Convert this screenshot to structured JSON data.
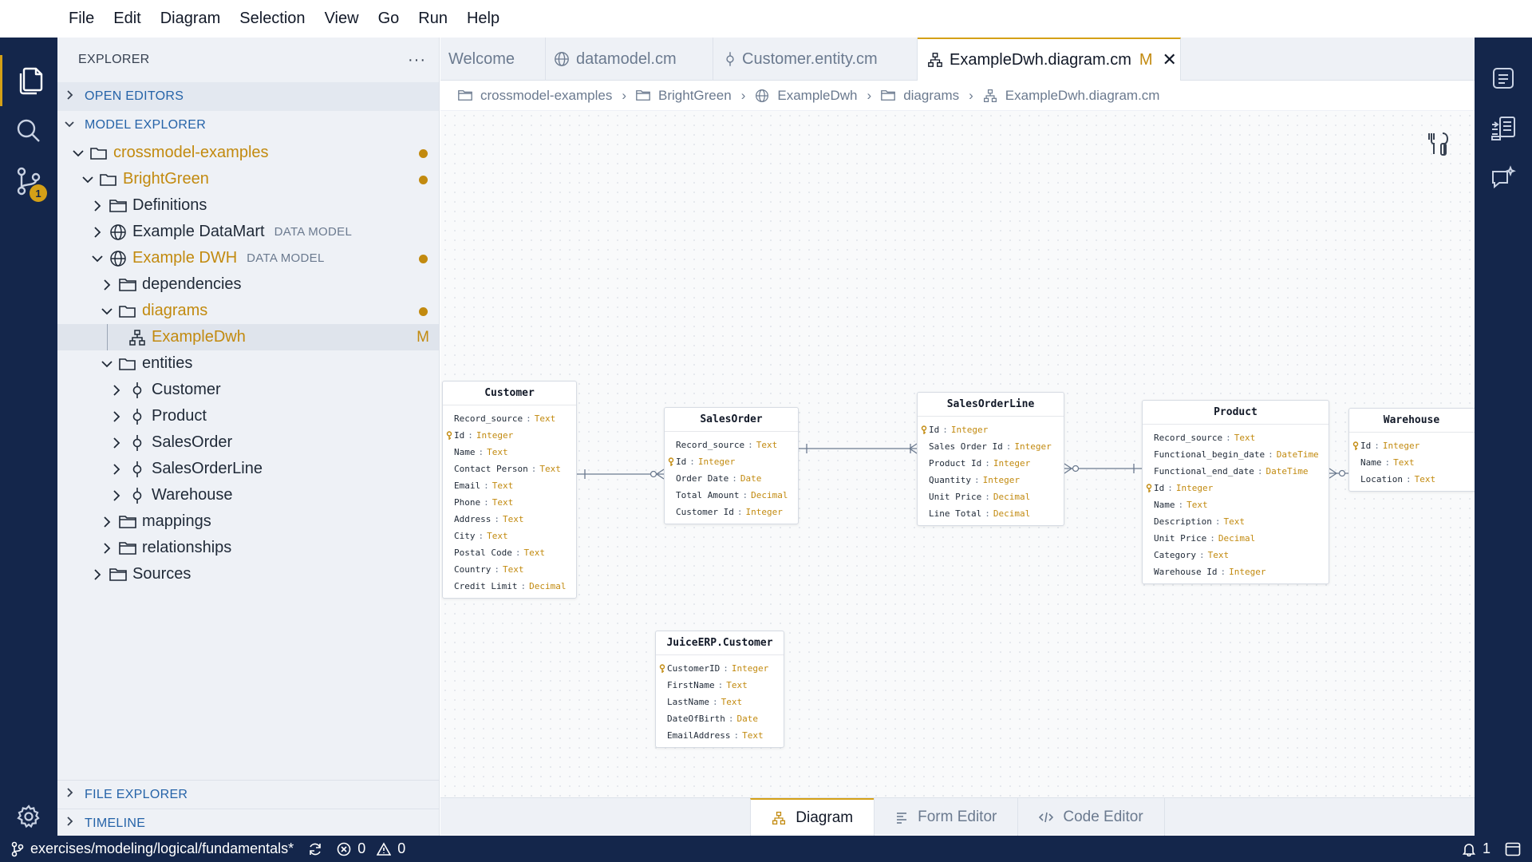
{
  "menu": [
    "File",
    "Edit",
    "Diagram",
    "Selection",
    "View",
    "Go",
    "Run",
    "Help"
  ],
  "activity": {
    "scm_badge": "1"
  },
  "explorer": {
    "title": "EXPLORER",
    "more": "···",
    "open_editors": "OPEN EDITORS",
    "model_explorer": "MODEL EXPLORER",
    "file_explorer": "FILE EXPLORER",
    "timeline": "TIMELINE",
    "tree": [
      {
        "label": "crossmodel-examples",
        "desc": "",
        "flag": "dot"
      },
      {
        "label": "BrightGreen",
        "desc": "",
        "flag": "dot"
      },
      {
        "label": "Definitions",
        "desc": "",
        "flag": ""
      },
      {
        "label": "Example DataMart",
        "desc": "DATA MODEL",
        "flag": ""
      },
      {
        "label": "Example DWH",
        "desc": "DATA MODEL",
        "flag": "dot"
      },
      {
        "label": "dependencies",
        "desc": "",
        "flag": ""
      },
      {
        "label": "diagrams",
        "desc": "",
        "flag": "dot"
      },
      {
        "label": "ExampleDwh",
        "desc": "",
        "flag": "M"
      },
      {
        "label": "entities",
        "desc": "",
        "flag": ""
      },
      {
        "label": "Customer",
        "desc": "",
        "flag": ""
      },
      {
        "label": "Product",
        "desc": "",
        "flag": ""
      },
      {
        "label": "SalesOrder",
        "desc": "",
        "flag": ""
      },
      {
        "label": "SalesOrderLine",
        "desc": "",
        "flag": ""
      },
      {
        "label": "Warehouse",
        "desc": "",
        "flag": ""
      },
      {
        "label": "mappings",
        "desc": "",
        "flag": ""
      },
      {
        "label": "relationships",
        "desc": "",
        "flag": ""
      },
      {
        "label": "Sources",
        "desc": "",
        "flag": ""
      }
    ]
  },
  "tabs": [
    {
      "label": "Welcome"
    },
    {
      "label": "datamodel.cm"
    },
    {
      "label": "Customer.entity.cm"
    },
    {
      "label": "ExampleDwh.diagram.cm",
      "modified": "M",
      "close": "✕"
    }
  ],
  "breadcrumb": [
    "crossmodel-examples",
    "BrightGreen",
    "ExampleDwh",
    "diagrams",
    "ExampleDwh.diagram.cm"
  ],
  "entities": {
    "customer": {
      "name": "Customer",
      "attrs": [
        {
          "n": "Record_source",
          "t": "Text"
        },
        {
          "n": "Id",
          "t": "Integer"
        },
        {
          "n": "Name",
          "t": "Text"
        },
        {
          "n": "Contact Person",
          "t": "Text"
        },
        {
          "n": "Email",
          "t": "Text"
        },
        {
          "n": "Phone",
          "t": "Text"
        },
        {
          "n": "Address",
          "t": "Text"
        },
        {
          "n": "City",
          "t": "Text"
        },
        {
          "n": "Postal Code",
          "t": "Text"
        },
        {
          "n": "Country",
          "t": "Text"
        },
        {
          "n": "Credit Limit",
          "t": "Decimal"
        }
      ]
    },
    "salesorder": {
      "name": "SalesOrder",
      "attrs": [
        {
          "n": "Record_source",
          "t": "Text"
        },
        {
          "n": "Id",
          "t": "Integer"
        },
        {
          "n": "Order Date",
          "t": "Date"
        },
        {
          "n": "Total Amount",
          "t": "Decimal"
        },
        {
          "n": "Customer Id",
          "t": "Integer"
        }
      ]
    },
    "salesorderline": {
      "name": "SalesOrderLine",
      "attrs": [
        {
          "n": "Id",
          "t": "Integer"
        },
        {
          "n": "Sales Order Id",
          "t": "Integer"
        },
        {
          "n": "Product Id",
          "t": "Integer"
        },
        {
          "n": "Quantity",
          "t": "Integer"
        },
        {
          "n": "Unit Price",
          "t": "Decimal"
        },
        {
          "n": "Line Total",
          "t": "Decimal"
        }
      ]
    },
    "product": {
      "name": "Product",
      "attrs": [
        {
          "n": "Record_source",
          "t": "Text"
        },
        {
          "n": "Functional_begin_date",
          "t": "DateTime"
        },
        {
          "n": "Functional_end_date",
          "t": "DateTime"
        },
        {
          "n": "Id",
          "t": "Integer"
        },
        {
          "n": "Name",
          "t": "Text"
        },
        {
          "n": "Description",
          "t": "Text"
        },
        {
          "n": "Unit Price",
          "t": "Decimal"
        },
        {
          "n": "Category",
          "t": "Text"
        },
        {
          "n": "Warehouse Id",
          "t": "Integer"
        }
      ]
    },
    "warehouse": {
      "name": "Warehouse",
      "attrs": [
        {
          "n": "Id",
          "t": "Integer"
        },
        {
          "n": "Name",
          "t": "Text"
        },
        {
          "n": "Location",
          "t": "Text"
        }
      ]
    },
    "juice": {
      "name": "JuiceERP.Customer",
      "attrs": [
        {
          "n": "CustomerID",
          "t": "Integer"
        },
        {
          "n": "FirstName",
          "t": "Text"
        },
        {
          "n": "LastName",
          "t": "Text"
        },
        {
          "n": "DateOfBirth",
          "t": "Date"
        },
        {
          "n": "EmailAddress",
          "t": "Text"
        }
      ]
    }
  },
  "editor_tabs": [
    "Diagram",
    "Form Editor",
    "Code Editor"
  ],
  "status": {
    "branch": "exercises/modeling/logical/fundamentals*",
    "errors": "0",
    "warnings": "0",
    "notifications": "1"
  },
  "colors": {
    "accent": "#d4a017",
    "modified": "#c28a0f",
    "activity_bg": "#14264b",
    "link": "#2563a8"
  }
}
